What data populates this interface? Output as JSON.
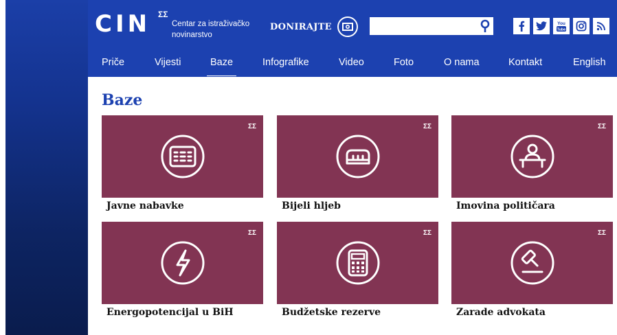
{
  "header": {
    "logo_text": "CIN",
    "logo_mark": "ΣΣ",
    "tagline": "Centar za istraživačko novinarstvo",
    "donate_label": "DONIRAJTE",
    "search": {
      "value": "",
      "placeholder": ""
    },
    "social": [
      {
        "name": "facebook-icon",
        "glyph": "f"
      },
      {
        "name": "twitter-icon",
        "glyph": "t"
      },
      {
        "name": "youtube-icon",
        "glyph": "You Tube"
      },
      {
        "name": "instagram-icon",
        "glyph": ""
      },
      {
        "name": "rss-icon",
        "glyph": ""
      }
    ],
    "colors": {
      "header_bg": "#1c41b0",
      "card_bg": "#823453",
      "title": "#1c41b0"
    }
  },
  "nav": {
    "items": [
      {
        "label": "Priče"
      },
      {
        "label": "Vijesti"
      },
      {
        "label": "Baze",
        "active": true
      },
      {
        "label": "Infografike"
      },
      {
        "label": "Video"
      },
      {
        "label": "Foto"
      },
      {
        "label": "O nama"
      },
      {
        "label": "Kontakt"
      },
      {
        "label": "English"
      }
    ]
  },
  "main": {
    "title": "Baze",
    "cards": [
      {
        "title": "Javne nabavke",
        "icon": "table-list-icon"
      },
      {
        "title": "Bijeli hljeb",
        "icon": "bread-icon"
      },
      {
        "title": "Imovina političara",
        "icon": "politician-desk-icon"
      },
      {
        "title": "Energopotencijal u BiH",
        "icon": "lightning-icon"
      },
      {
        "title": "Budžetske rezerve",
        "icon": "calculator-icon"
      },
      {
        "title": "Zarade advokata",
        "icon": "gavel-icon"
      }
    ]
  }
}
